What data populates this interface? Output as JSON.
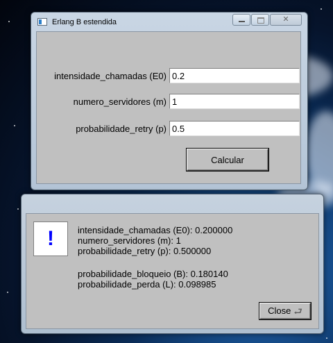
{
  "main_window": {
    "title": "Erlang B estendida",
    "fields": [
      {
        "label": "intensidade_chamadas (E0)",
        "value": "0.2"
      },
      {
        "label": "numero_servidores (m)",
        "value": "1"
      },
      {
        "label": "probabilidade_retry (p)",
        "value": "0.5"
      }
    ],
    "calculate_label": "Calcular"
  },
  "result_dialog": {
    "icon_glyph": "!",
    "lines": [
      "intensidade_chamadas (E0): 0.200000",
      "numero_servidores (m): 1",
      "probabilidade_retry (p): 0.500000",
      "probabilidade_bloqueio (B): 0.180140",
      "probabilidade_perda (L): 0.098985"
    ],
    "close_label": "Close",
    "close_icon": "return-arrow-icon"
  },
  "colors": {
    "alert_glyph": "#0000ff",
    "window_face": "#c0c0c0"
  }
}
